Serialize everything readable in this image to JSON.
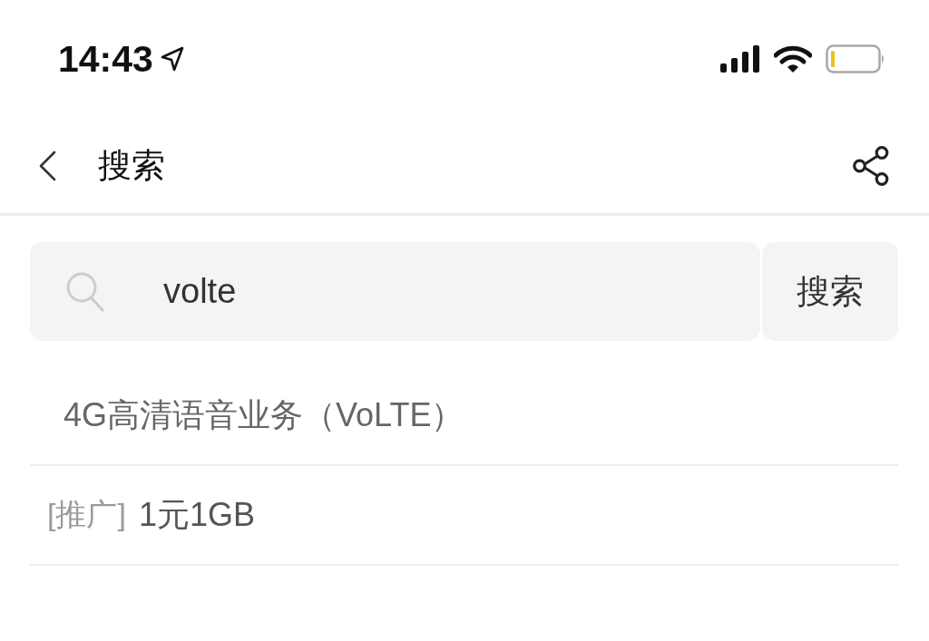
{
  "status_bar": {
    "time": "14:43"
  },
  "nav_bar": {
    "title": "搜索"
  },
  "search": {
    "value": "volte",
    "button": "搜索"
  },
  "suggestions": [
    {
      "kind": "plain",
      "text": "4G高清语音业务（VoLTE）"
    },
    {
      "kind": "promoted",
      "tag": "[推广]",
      "text": "1元1GB"
    }
  ]
}
